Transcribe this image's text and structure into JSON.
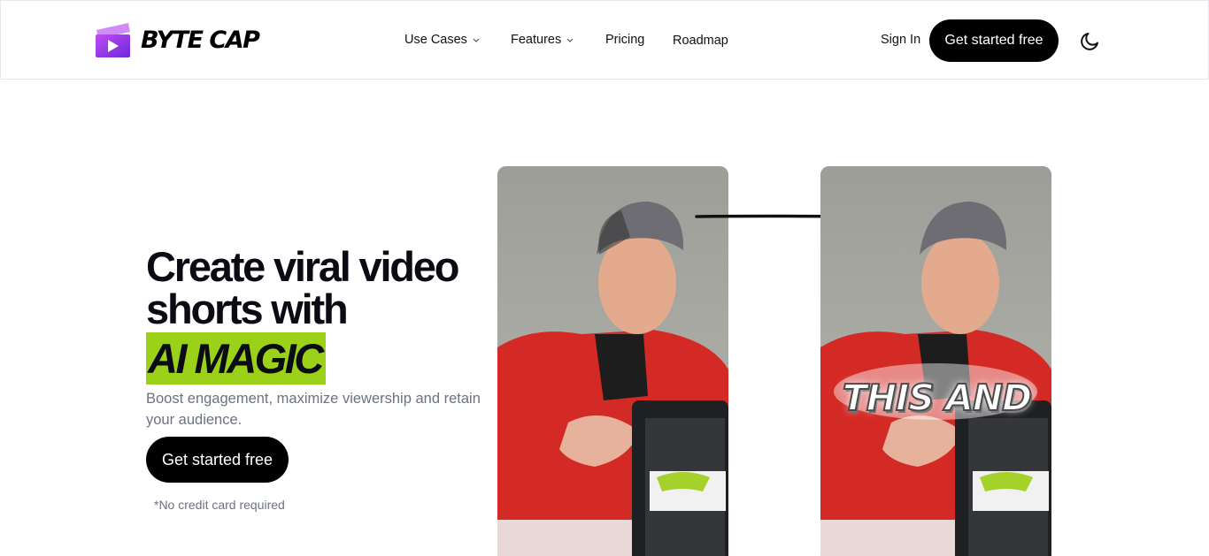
{
  "brand": {
    "name": "BYTE CAP",
    "logo_color": "#8b3cf6"
  },
  "nav": {
    "items": [
      {
        "label": "Use Cases",
        "has_dropdown": true
      },
      {
        "label": "Features",
        "has_dropdown": true
      },
      {
        "label": "Pricing",
        "has_dropdown": false
      },
      {
        "label": "Roadmap",
        "has_dropdown": false
      }
    ],
    "sign_in": "Sign In",
    "cta": "Get started free",
    "theme_icon": "moon-icon"
  },
  "hero": {
    "title": "Create viral video shorts with",
    "highlight": "AI MAGIC",
    "highlight_color": "#9bd118",
    "subtitle": "Boost engagement, maximize viewership and retain your audience.",
    "cta": "Get started free",
    "note": "*No credit card required"
  },
  "demo": {
    "before_label": "",
    "after_caption": "THIS AND"
  }
}
